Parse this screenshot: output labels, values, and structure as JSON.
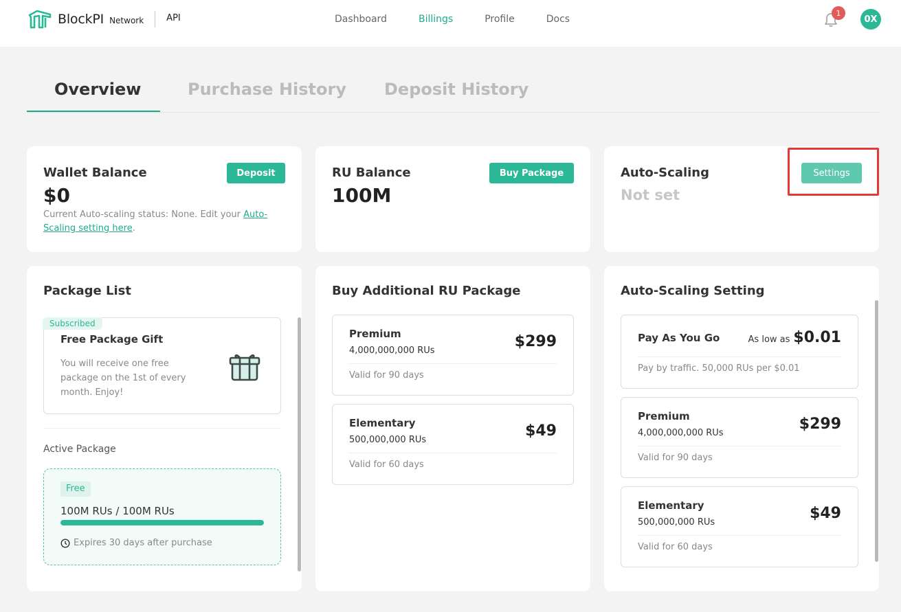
{
  "header": {
    "brand": "BlockPI",
    "brand_sub": "Network",
    "product": "API",
    "nav": [
      "Dashboard",
      "Billings",
      "Profile",
      "Docs"
    ],
    "active_nav": "Billings",
    "notification_count": "1",
    "avatar_text": "0X"
  },
  "tabs": [
    "Overview",
    "Purchase History",
    "Deposit History"
  ],
  "wallet": {
    "title": "Wallet Balance",
    "value": "$0",
    "button": "Deposit",
    "note_prefix": "Current Auto-scaling status: None. Edit your ",
    "note_link": "Auto-Scaling setting here",
    "note_suffix": "."
  },
  "ru_balance": {
    "title": "RU Balance",
    "value": "100M",
    "button": "Buy Package"
  },
  "auto_scaling": {
    "title": "Auto-Scaling",
    "value": "Not set",
    "button": "Settings"
  },
  "package_list": {
    "title": "Package List",
    "tag": "Subscribed",
    "gift_title": "Free Package Gift",
    "gift_text_lines": [
      "You will receive one free",
      "package on the 1st of every",
      "month. Enjoy!"
    ],
    "active_label": "Active Package",
    "active_chip": "Free",
    "usage_used": "100M RUs",
    "usage_sep": "/",
    "usage_total": "100M RUs",
    "usage_fraction": 1.0,
    "expires": "Expires 30 days after purchase"
  },
  "buy_additional": {
    "title": "Buy Additional RU Package",
    "packages": [
      {
        "name": "Premium",
        "rus": "4,000,000,000 RUs",
        "price": "$299",
        "valid": "Valid for 90 days"
      },
      {
        "name": "Elementary",
        "rus": "500,000,000 RUs",
        "price": "$49",
        "valid": "Valid for 60 days"
      }
    ]
  },
  "auto_scaling_setting": {
    "title": "Auto-Scaling Setting",
    "payg": {
      "name": "Pay As You Go",
      "low_label": "As low as",
      "price": "$0.01",
      "desc": "Pay by traffic. 50,000 RUs per $0.01"
    },
    "packages": [
      {
        "name": "Premium",
        "rus": "4,000,000,000 RUs",
        "price": "$299",
        "valid": "Valid for 90 days"
      },
      {
        "name": "Elementary",
        "rus": "500,000,000 RUs",
        "price": "$49",
        "valid": "Valid for 60 days"
      }
    ]
  },
  "colors": {
    "accent": "#2bb896",
    "highlight": "#e53935",
    "badge": "#e25a5a"
  }
}
